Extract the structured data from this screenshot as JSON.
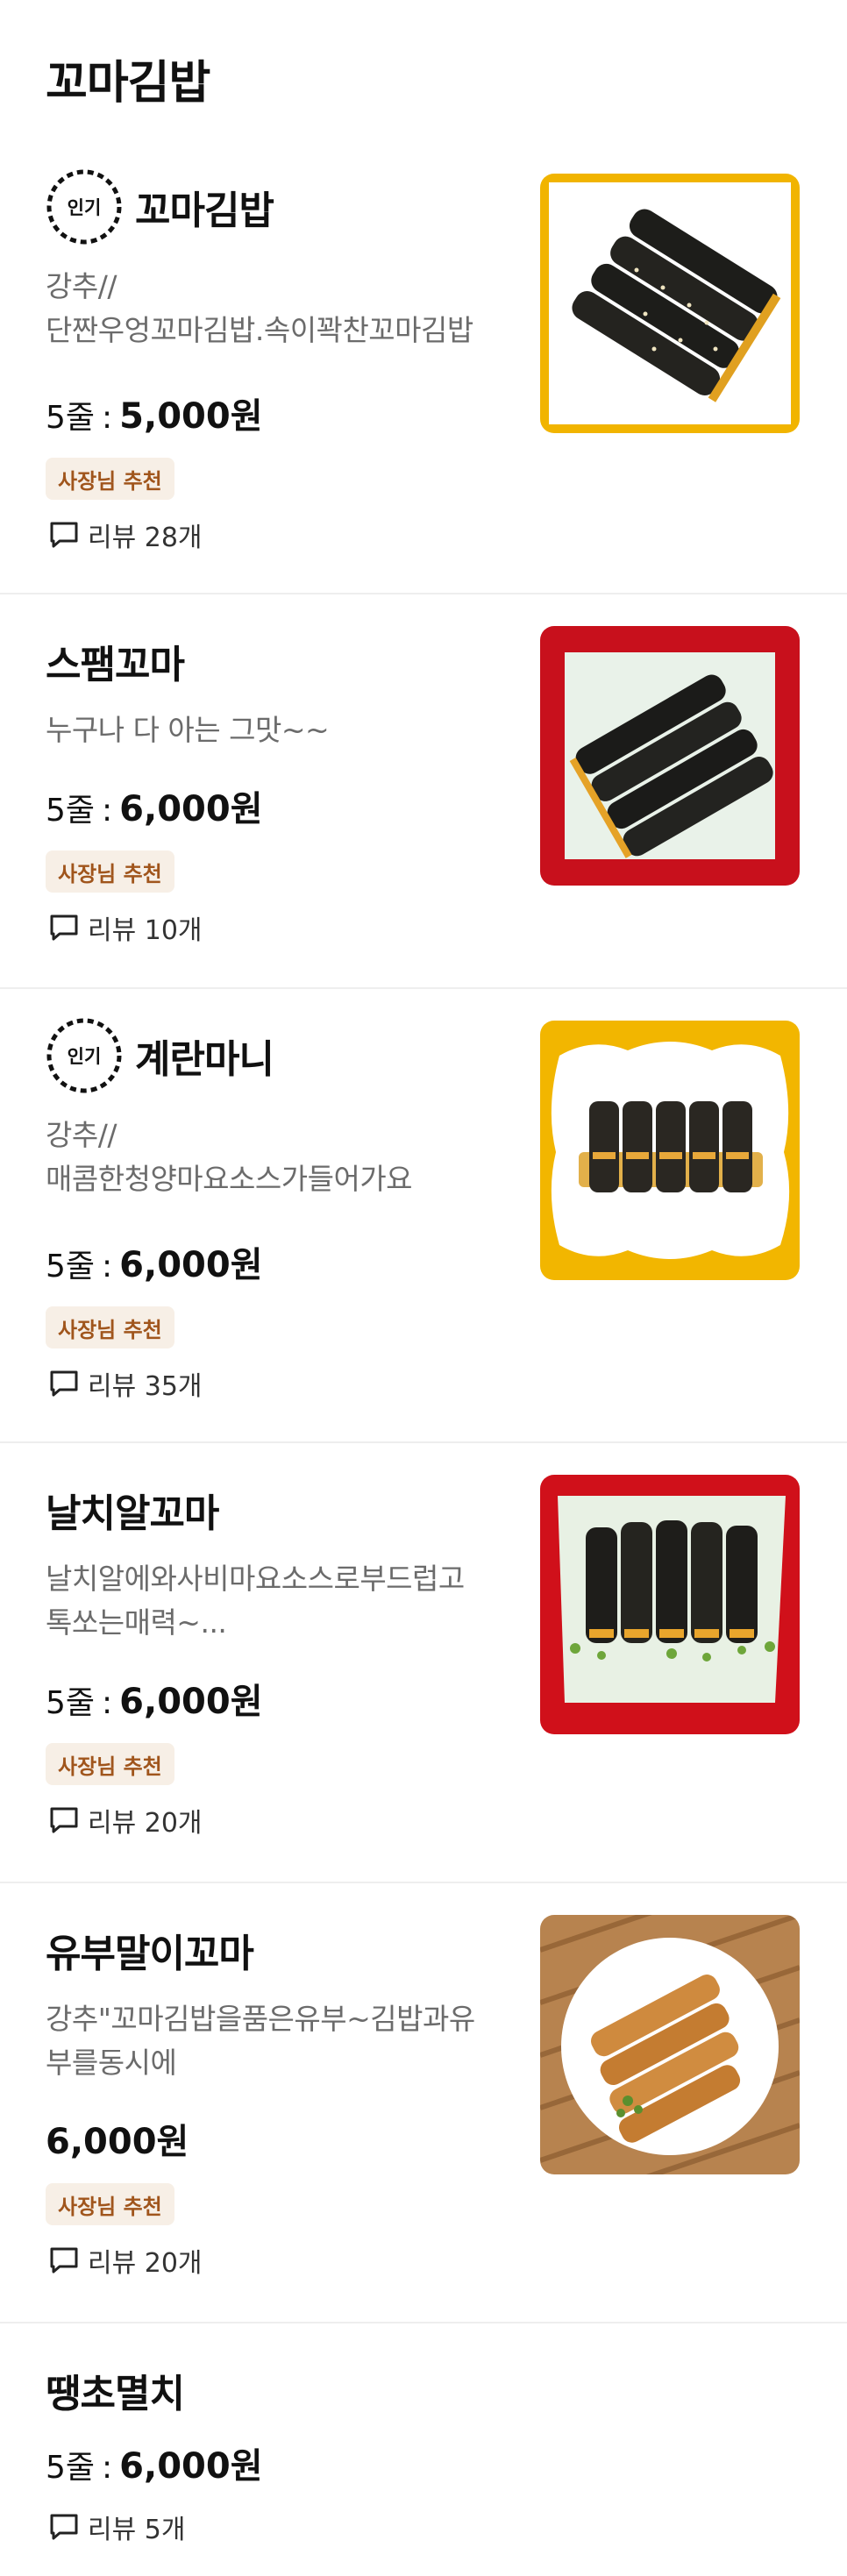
{
  "section": {
    "title": "꼬마김밥"
  },
  "badge_label": "인기",
  "items": [
    {
      "name": "꼬마김밥",
      "popular": true,
      "desc": [
        "강추//",
        "단짠우엉꼬마김밥.속이꽉찬꼬마김밥"
      ],
      "qty": "5줄",
      "price": "5,000원",
      "tag": "사장님 추천",
      "reviews": "리뷰 28개",
      "image": {
        "frame": "#f1b400",
        "plate": "#ffffff",
        "style": "square"
      }
    },
    {
      "name": "스팸꼬마",
      "popular": false,
      "desc": [
        "누구나 다 아는 그맛~~"
      ],
      "qty": "5줄",
      "price": "6,000원",
      "tag": "사장님 추천",
      "reviews": "리뷰 10개",
      "image": {
        "frame": "#c8101c",
        "plate": "#e9f2e9",
        "style": "square"
      }
    },
    {
      "name": "계란마니",
      "popular": true,
      "desc": [
        "강추//",
        "매콤한청양마요소스가들어가요"
      ],
      "qty": "5줄",
      "price": "6,000원",
      "tag": "사장님 추천",
      "reviews": "리뷰 35개",
      "image": {
        "frame": "#f2b600",
        "plate": "#ffffff",
        "style": "wavy"
      }
    },
    {
      "name": "날치알꼬마",
      "popular": false,
      "desc": [
        "날치알에와사비마요소스로부드럽고",
        "톡쏘는매력~..."
      ],
      "qty": "5줄",
      "price": "6,000원",
      "tag": "사장님 추천",
      "reviews": "리뷰 20개",
      "image": {
        "frame": "#d0101a",
        "plate": "#e8f1e4",
        "style": "square"
      }
    },
    {
      "name": "유부말이꼬마",
      "popular": false,
      "desc": [
        "강추\"꼬마김밥을품은유부~김밥과유",
        "부를동시에"
      ],
      "qty": "",
      "price": "6,000원",
      "tag": "사장님 추천",
      "reviews": "리뷰 20개",
      "image": {
        "frame": "#b7834f",
        "plate": "#ffffff",
        "style": "round"
      }
    },
    {
      "name": "땡초멸치",
      "popular": false,
      "desc": [],
      "qty": "5줄",
      "price": "6,000원",
      "tag": "",
      "reviews": "리뷰 5개",
      "image": null
    }
  ]
}
